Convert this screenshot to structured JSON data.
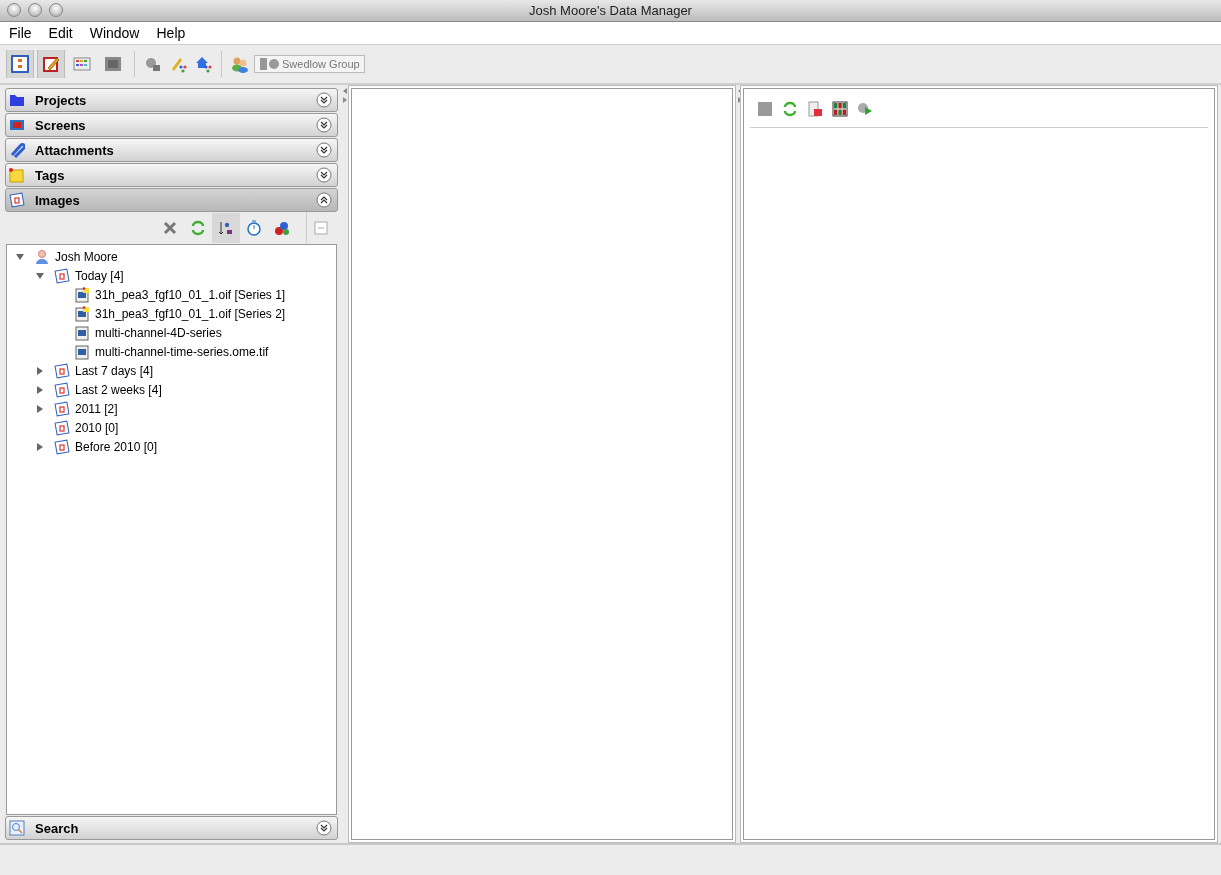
{
  "window": {
    "title": "Josh Moore's Data Manager"
  },
  "menu": [
    "File",
    "Edit",
    "Window",
    "Help"
  ],
  "toolbar": {
    "buttons": [
      {
        "kind": "tree",
        "selected": true
      },
      {
        "kind": "edit",
        "selected": true
      },
      {
        "kind": "grid",
        "selected": false
      },
      {
        "kind": "viewer",
        "selected": false
      }
    ],
    "group": {
      "label": "Swedlow Group"
    }
  },
  "sections": [
    {
      "kind": "projects",
      "label": "Projects",
      "expanded": false
    },
    {
      "kind": "screens",
      "label": "Screens",
      "expanded": false
    },
    {
      "kind": "attachments",
      "label": "Attachments",
      "expanded": false
    },
    {
      "kind": "tags",
      "label": "Tags",
      "expanded": false
    },
    {
      "kind": "images",
      "label": "Images",
      "expanded": true
    }
  ],
  "image_tools": [
    {
      "kind": "delete",
      "selected": false
    },
    {
      "kind": "refresh",
      "selected": false
    },
    {
      "kind": "sort",
      "selected": true
    },
    {
      "kind": "timer",
      "selected": false
    },
    {
      "kind": "abc",
      "selected": false
    },
    {
      "kind": "collapse",
      "selected": false
    }
  ],
  "tree": [
    {
      "kind": "user",
      "label": "Josh Moore",
      "expanded": true,
      "children": [
        {
          "kind": "date",
          "label": "Today [4]",
          "expanded": true,
          "children": [
            {
              "kind": "tagged-image",
              "label": "31h_pea3_fgf10_01_1.oif [Series 1]"
            },
            {
              "kind": "tagged-image",
              "label": "31h_pea3_fgf10_01_1.oif [Series 2]"
            },
            {
              "kind": "image",
              "label": "multi-channel-4D-series"
            },
            {
              "kind": "image",
              "label": "multi-channel-time-series.ome.tif"
            }
          ]
        },
        {
          "kind": "date",
          "label": "Last 7 days [4]",
          "expanded": false
        },
        {
          "kind": "date",
          "label": "Last 2 weeks [4]",
          "expanded": false
        },
        {
          "kind": "date",
          "label": "2011 [2]",
          "expanded": false
        },
        {
          "kind": "date",
          "label": "2010 [0]"
        },
        {
          "kind": "date",
          "label": "Before 2010 [0]",
          "expanded": false
        }
      ]
    }
  ],
  "search_section": {
    "label": "Search",
    "expanded": false
  },
  "right_tools": [
    {
      "kind": "save"
    },
    {
      "kind": "refresh"
    },
    {
      "kind": "export"
    },
    {
      "kind": "grid"
    },
    {
      "kind": "run"
    }
  ]
}
